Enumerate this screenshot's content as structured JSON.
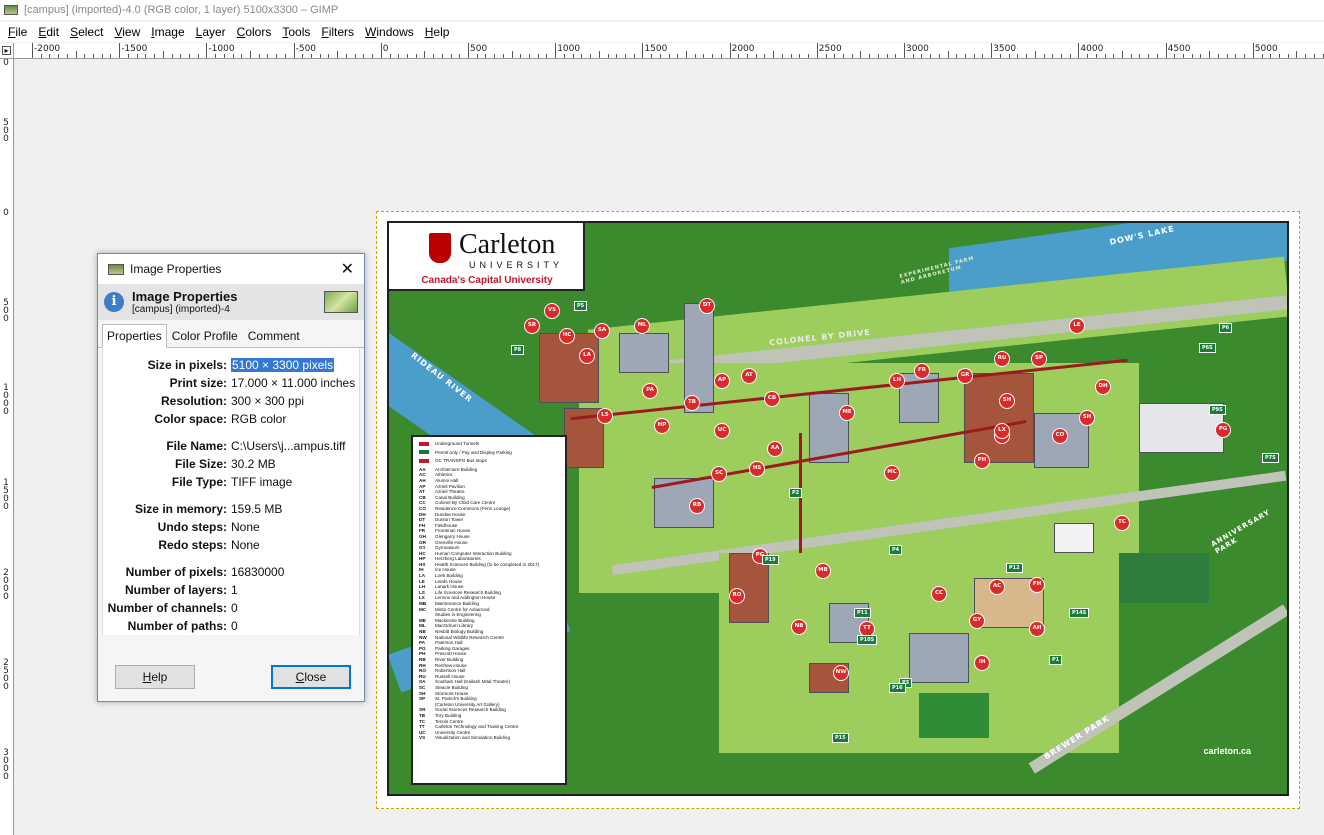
{
  "window": {
    "title": "[campus] (imported)-4.0 (RGB color, 1 layer) 5100x3300 – GIMP"
  },
  "menu": [
    "File",
    "Edit",
    "Select",
    "View",
    "Image",
    "Layer",
    "Colors",
    "Tools",
    "Filters",
    "Windows",
    "Help"
  ],
  "ruler": {
    "h_labels": [
      "-2000",
      "-1500",
      "-1000",
      "-500",
      "0",
      "500",
      "1000",
      "1500",
      "2000",
      "2500",
      "3000",
      "3500",
      "4000",
      "4500",
      "5000"
    ],
    "v_labels": [
      "0",
      "500",
      "0",
      "500",
      "1000",
      "1500",
      "2000",
      "2500",
      "3000"
    ]
  },
  "dialog": {
    "window_title": "Image Properties",
    "header_title": "Image Properties",
    "header_subtitle": "[campus] (imported)-4",
    "tabs": [
      "Properties",
      "Color Profile",
      "Comment"
    ],
    "properties": [
      {
        "label": "Size in pixels:",
        "value": "5100 × 3300 pixels"
      },
      {
        "label": "Print size:",
        "value": "17.000 × 11.000 inches"
      },
      {
        "label": "Resolution:",
        "value": "300 × 300 ppi"
      },
      {
        "label": "Color space:",
        "value": "RGB color"
      },
      {
        "label": "File Name:",
        "value": "C:\\Users\\j...ampus.tiff"
      },
      {
        "label": "File Size:",
        "value": "30.2 MB"
      },
      {
        "label": "File Type:",
        "value": "TIFF image"
      },
      {
        "label": "Size in memory:",
        "value": "159.5 MB"
      },
      {
        "label": "Undo steps:",
        "value": "None"
      },
      {
        "label": "Redo steps:",
        "value": "None"
      },
      {
        "label": "Number of pixels:",
        "value": "16830000"
      },
      {
        "label": "Number of layers:",
        "value": "1"
      },
      {
        "label": "Number of channels:",
        "value": "0"
      },
      {
        "label": "Number of paths:",
        "value": "0"
      }
    ],
    "help_label": "Help",
    "close_label": "Close"
  },
  "map": {
    "logo_name": "Carleton",
    "logo_university": "UNIVERSITY",
    "logo_tagline": "Canada's Capital University",
    "labels": {
      "dows_lake": "DOW'S LAKE",
      "colonel_by": "COLONEL BY DRIVE",
      "rideau_river": "RIDEAU RIVER",
      "brewer_park": "BREWER PARK",
      "anniversary_park": "ANNIVERSARY PARK",
      "experimental_farm": "EXPERIMENTAL FARM AND ARBORETUM"
    },
    "website": "carleton.ca",
    "legend_heads": [
      "Underground Tunnels",
      "Permit only / Pay and Display Parking",
      "OC TRANSPO Bus stops"
    ],
    "legend": [
      [
        "AA",
        "Architecture Building"
      ],
      [
        "AC",
        "Athletics"
      ],
      [
        "AH",
        "Alumni Hall"
      ],
      [
        "AP",
        "Azrieli Pavilion"
      ],
      [
        "AT",
        "Azrieli Theatre"
      ],
      [
        "CB",
        "Canal Building"
      ],
      [
        "CC",
        "Colonel By Child Care Centre"
      ],
      [
        "CO",
        "Residence Commons (Fenn Lounge)"
      ],
      [
        "DH",
        "Dundas House"
      ],
      [
        "DT",
        "Dunton Tower"
      ],
      [
        "FH",
        "Fieldhouse"
      ],
      [
        "FR",
        "Frontenac House"
      ],
      [
        "GH",
        "Glengarry House"
      ],
      [
        "GR",
        "Grenville House"
      ],
      [
        "GY",
        "Gymnasium"
      ],
      [
        "HC",
        "Human Computer Interaction Building"
      ],
      [
        "HP",
        "Herzberg Laboratories"
      ],
      [
        "HS",
        "Health Sciences Building (to be completed in 2017)"
      ],
      [
        "IH",
        "Ice House"
      ],
      [
        "LA",
        "Loeb Building"
      ],
      [
        "LE",
        "Leeds House"
      ],
      [
        "LH",
        "Lanark House"
      ],
      [
        "LS",
        "Life Sciences Research Building"
      ],
      [
        "LX",
        "Lennox and Addington House"
      ],
      [
        "MB",
        "Maintenance Building"
      ],
      [
        "MC",
        "Minto Centre for Advanced"
      ],
      [
        "",
        "Studies in Engineering"
      ],
      [
        "ME",
        "Mackenzie Building"
      ],
      [
        "ML",
        "MacOdrum Library"
      ],
      [
        "NB",
        "Nesbitt Biology Building"
      ],
      [
        "NW",
        "National Wildlife Research Centre"
      ],
      [
        "PA",
        "Paterson Hall"
      ],
      [
        "PG",
        "Parking Garages"
      ],
      [
        "PH",
        "Prescott House"
      ],
      [
        "RB",
        "River Building"
      ],
      [
        "RH",
        "Renfrew House"
      ],
      [
        "RO",
        "Robertson Hall"
      ],
      [
        "RU",
        "Russell House"
      ],
      [
        "SA",
        "Southam Hall (Kailash Mital Theatre)"
      ],
      [
        "SC",
        "Steacie Building"
      ],
      [
        "SH",
        "Stormont House"
      ],
      [
        "SP",
        "St. Patrick's Building"
      ],
      [
        "",
        "(Carleton University Art Gallery)"
      ],
      [
        "SR",
        "Social Sciences Research Building"
      ],
      [
        "TB",
        "Tory Building"
      ],
      [
        "TC",
        "Tennis Centre"
      ],
      [
        "TT",
        "Carleton Technology and Training Centre"
      ],
      [
        "UC",
        "University Centre"
      ],
      [
        "VS",
        "Visualization and Simulation Building"
      ]
    ],
    "pins": [
      "DT",
      "VS",
      "SR",
      "HC",
      "LA",
      "SA",
      "ML",
      "PA",
      "LS",
      "HP",
      "AP",
      "TB",
      "AT",
      "UC",
      "CB",
      "AA",
      "HS",
      "SC",
      "RB",
      "ME",
      "MC",
      "LH",
      "FR",
      "GR",
      "RU",
      "SP",
      "LE",
      "DH",
      "SH",
      "BH",
      "PH",
      "LX",
      "CO",
      "SH",
      "PG",
      "TC",
      "PG",
      "MB",
      "RO",
      "NB",
      "TT",
      "NW",
      "CC",
      "AC",
      "FH",
      "GY",
      "AH",
      "IH"
    ],
    "parking": [
      "P5",
      "P6",
      "P8",
      "P6S",
      "P9S",
      "P7S",
      "P2",
      "P4",
      "P19",
      "P12",
      "P11",
      "P10S",
      "P3",
      "P14S",
      "P16",
      "P15",
      "P1"
    ]
  },
  "colors": {
    "map_green": "#3c8a2e",
    "river": "#4a9ec9",
    "pin_red": "#d92b2b",
    "selection": "#3478d2",
    "frame_dash": "#c9a500"
  }
}
